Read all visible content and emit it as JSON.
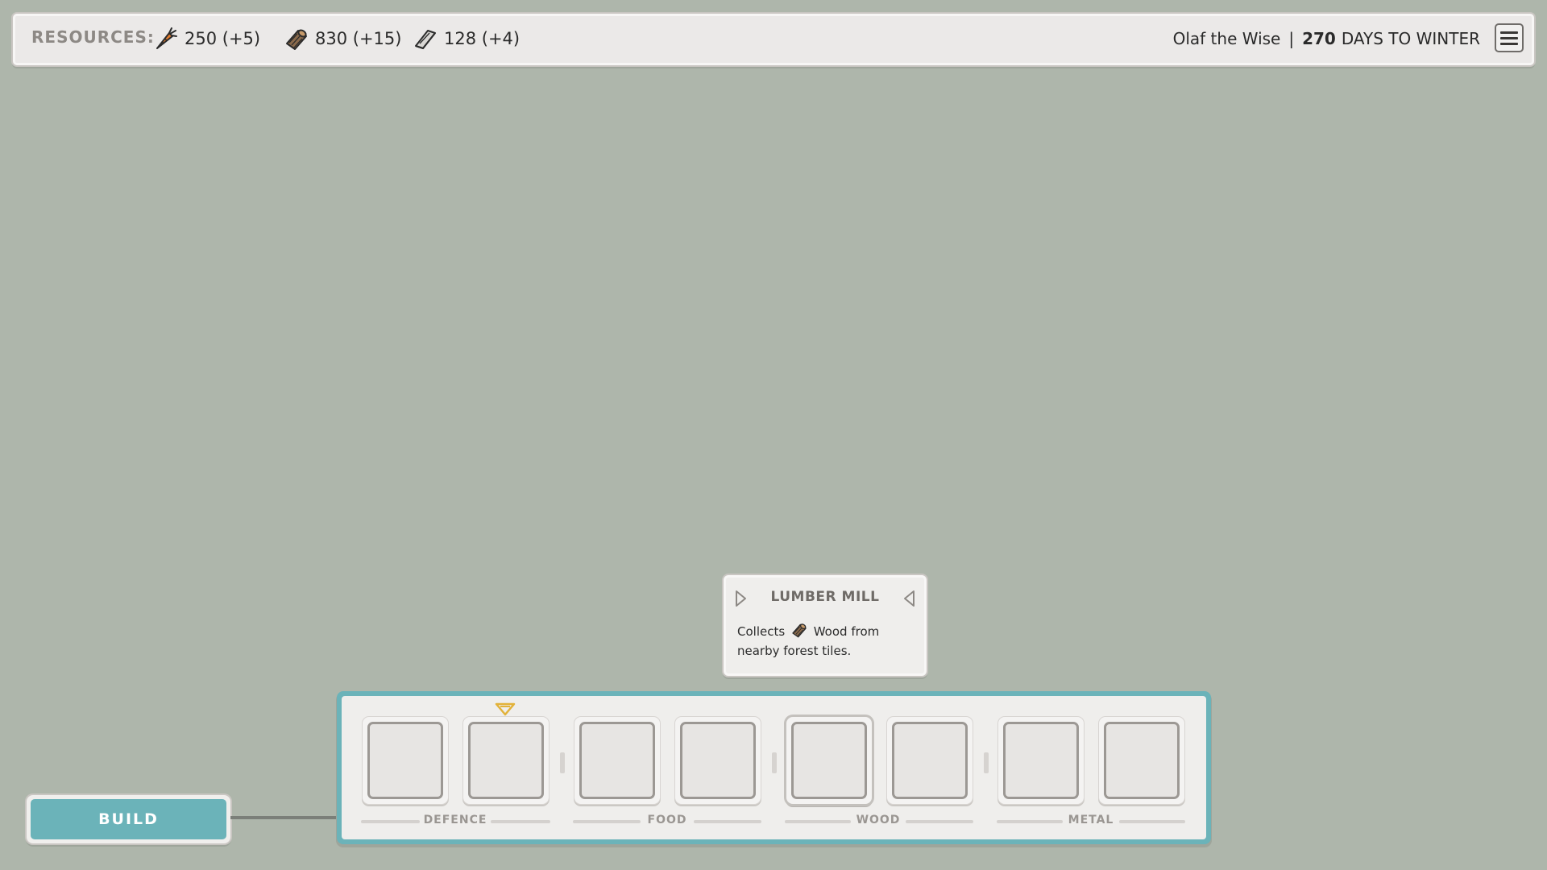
{
  "resources": {
    "label": "RESOURCES:",
    "items": [
      {
        "name": "food",
        "icon": "carrot-icon",
        "value": "250 (+5)"
      },
      {
        "name": "wood",
        "icon": "log-icon",
        "value": "830 (+15)"
      },
      {
        "name": "metal",
        "icon": "ingot-icon",
        "value": "128 (+4)"
      }
    ]
  },
  "player": {
    "name": "Olaf the Wise",
    "separator": "|",
    "days": "270",
    "days_label": "DAYS TO WINTER"
  },
  "menu": {
    "icon": "hamburger-icon"
  },
  "tooltip": {
    "title": "LUMBER MILL",
    "desc_before": "Collects",
    "desc_after": "Wood from nearby forest tiles."
  },
  "build": {
    "button_label": "BUILD",
    "groups": [
      {
        "label": "DEFENCE",
        "slots": 2
      },
      {
        "label": "FOOD",
        "slots": 2
      },
      {
        "label": "WOOD",
        "slots": 2
      },
      {
        "label": "METAL",
        "slots": 2
      }
    ],
    "selected_slot": "wood-1"
  },
  "colors": {
    "background": "#aeb6ab",
    "accent_teal": "#6bb3b9",
    "panel": "#efeeec",
    "indicator_gold": "#e2b23a"
  }
}
